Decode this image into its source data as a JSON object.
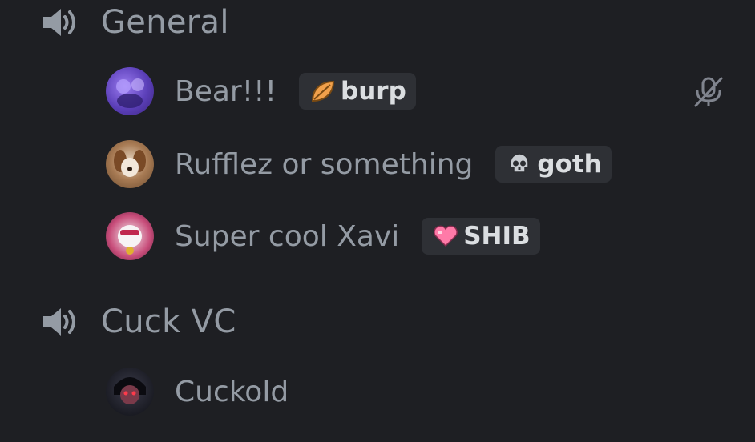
{
  "channels": [
    {
      "name": "General",
      "icon": "speaker-icon",
      "users": [
        {
          "username": "Bear!!!",
          "tag": {
            "label": "burp",
            "icon": "leaf-icon"
          },
          "muted": true,
          "avatar_color": "#6a4fd0"
        },
        {
          "username": "Rufflez or something",
          "tag": {
            "label": "goth",
            "icon": "skull-icon"
          },
          "muted": false,
          "avatar_color": "#8a5a3a"
        },
        {
          "username": "Super cool Xavi",
          "tag": {
            "label": "SHIB",
            "icon": "heart-icon"
          },
          "muted": false,
          "avatar_color": "#7a2a55"
        }
      ]
    },
    {
      "name": "Cuck VC",
      "icon": "speaker-icon",
      "users": [
        {
          "username": "Cuckold",
          "tag": null,
          "muted": false,
          "avatar_color": "#2a2d3a"
        }
      ]
    }
  ],
  "colors": {
    "background": "#1e1f23",
    "text_muted": "#949ba4",
    "tag_bg": "#2e3035",
    "tag_text": "#dbdee1"
  }
}
